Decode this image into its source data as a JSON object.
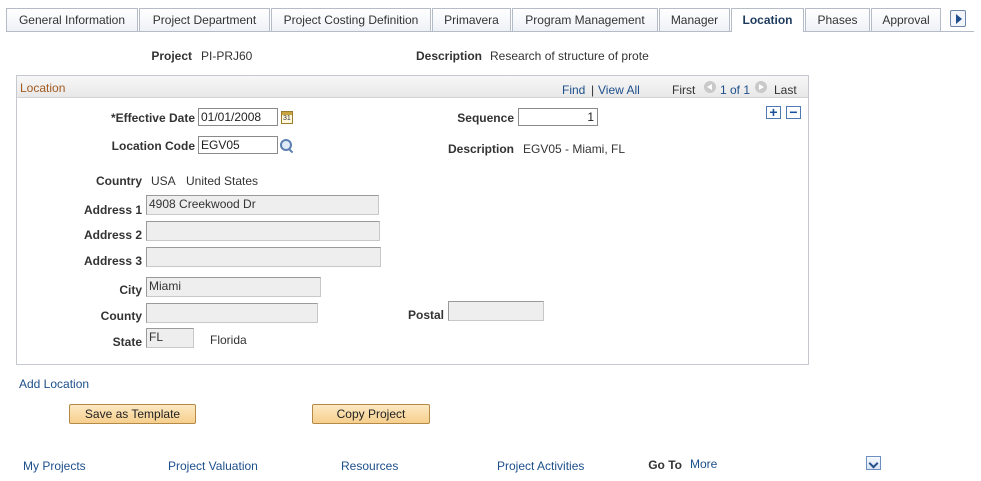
{
  "tabs": [
    {
      "label": "General Information",
      "active": false
    },
    {
      "label": "Project Department",
      "active": false
    },
    {
      "label": "Project Costing Definition",
      "active": false
    },
    {
      "label": "Primavera",
      "active": false
    },
    {
      "label": "Program Management",
      "active": false
    },
    {
      "label": "Manager",
      "active": false
    },
    {
      "label": "Location",
      "active": true
    },
    {
      "label": "Phases",
      "active": false
    },
    {
      "label": "Approval",
      "active": false
    }
  ],
  "header": {
    "project_label": "Project",
    "project_value": "PI-PRJ60",
    "description_label": "Description",
    "description_value": "Research of structure of prote"
  },
  "location": {
    "title": "Location",
    "nav": {
      "find": "Find",
      "separator": "|",
      "view_all": "View All",
      "first": "First",
      "range": "1 of 1",
      "last": "Last"
    },
    "effective_date_label": "*Effective Date",
    "effective_date_value": "01/01/2008",
    "calendar_text": "31",
    "sequence_label": "Sequence",
    "sequence_value": "1",
    "add_row": "+",
    "delete_row": "−",
    "location_code_label": "Location Code",
    "location_code_value": "EGV05",
    "loc_description_label": "Description",
    "loc_description_value": "EGV05 - Miami,  FL",
    "country_label": "Country",
    "country_code": "USA",
    "country_name": "United States",
    "address1_label": "Address 1",
    "address1_value": "4908 Creekwood Dr",
    "address2_label": "Address 2",
    "address2_value": "",
    "address3_label": "Address 3",
    "address3_value": "",
    "city_label": "City",
    "city_value": "Miami",
    "county_label": "County",
    "county_value": "",
    "postal_label": "Postal",
    "postal_value": "",
    "state_label": "State",
    "state_code": "FL",
    "state_name": "Florida"
  },
  "add_location": "Add Location",
  "buttons": {
    "save_template": "Save as Template",
    "copy_project": "Copy Project"
  },
  "footer": {
    "my_projects": "My Projects",
    "project_valuation": "Project Valuation",
    "resources": "Resources",
    "project_activities": "Project Activities",
    "go_to_label": "Go To",
    "go_to_value": "More"
  }
}
